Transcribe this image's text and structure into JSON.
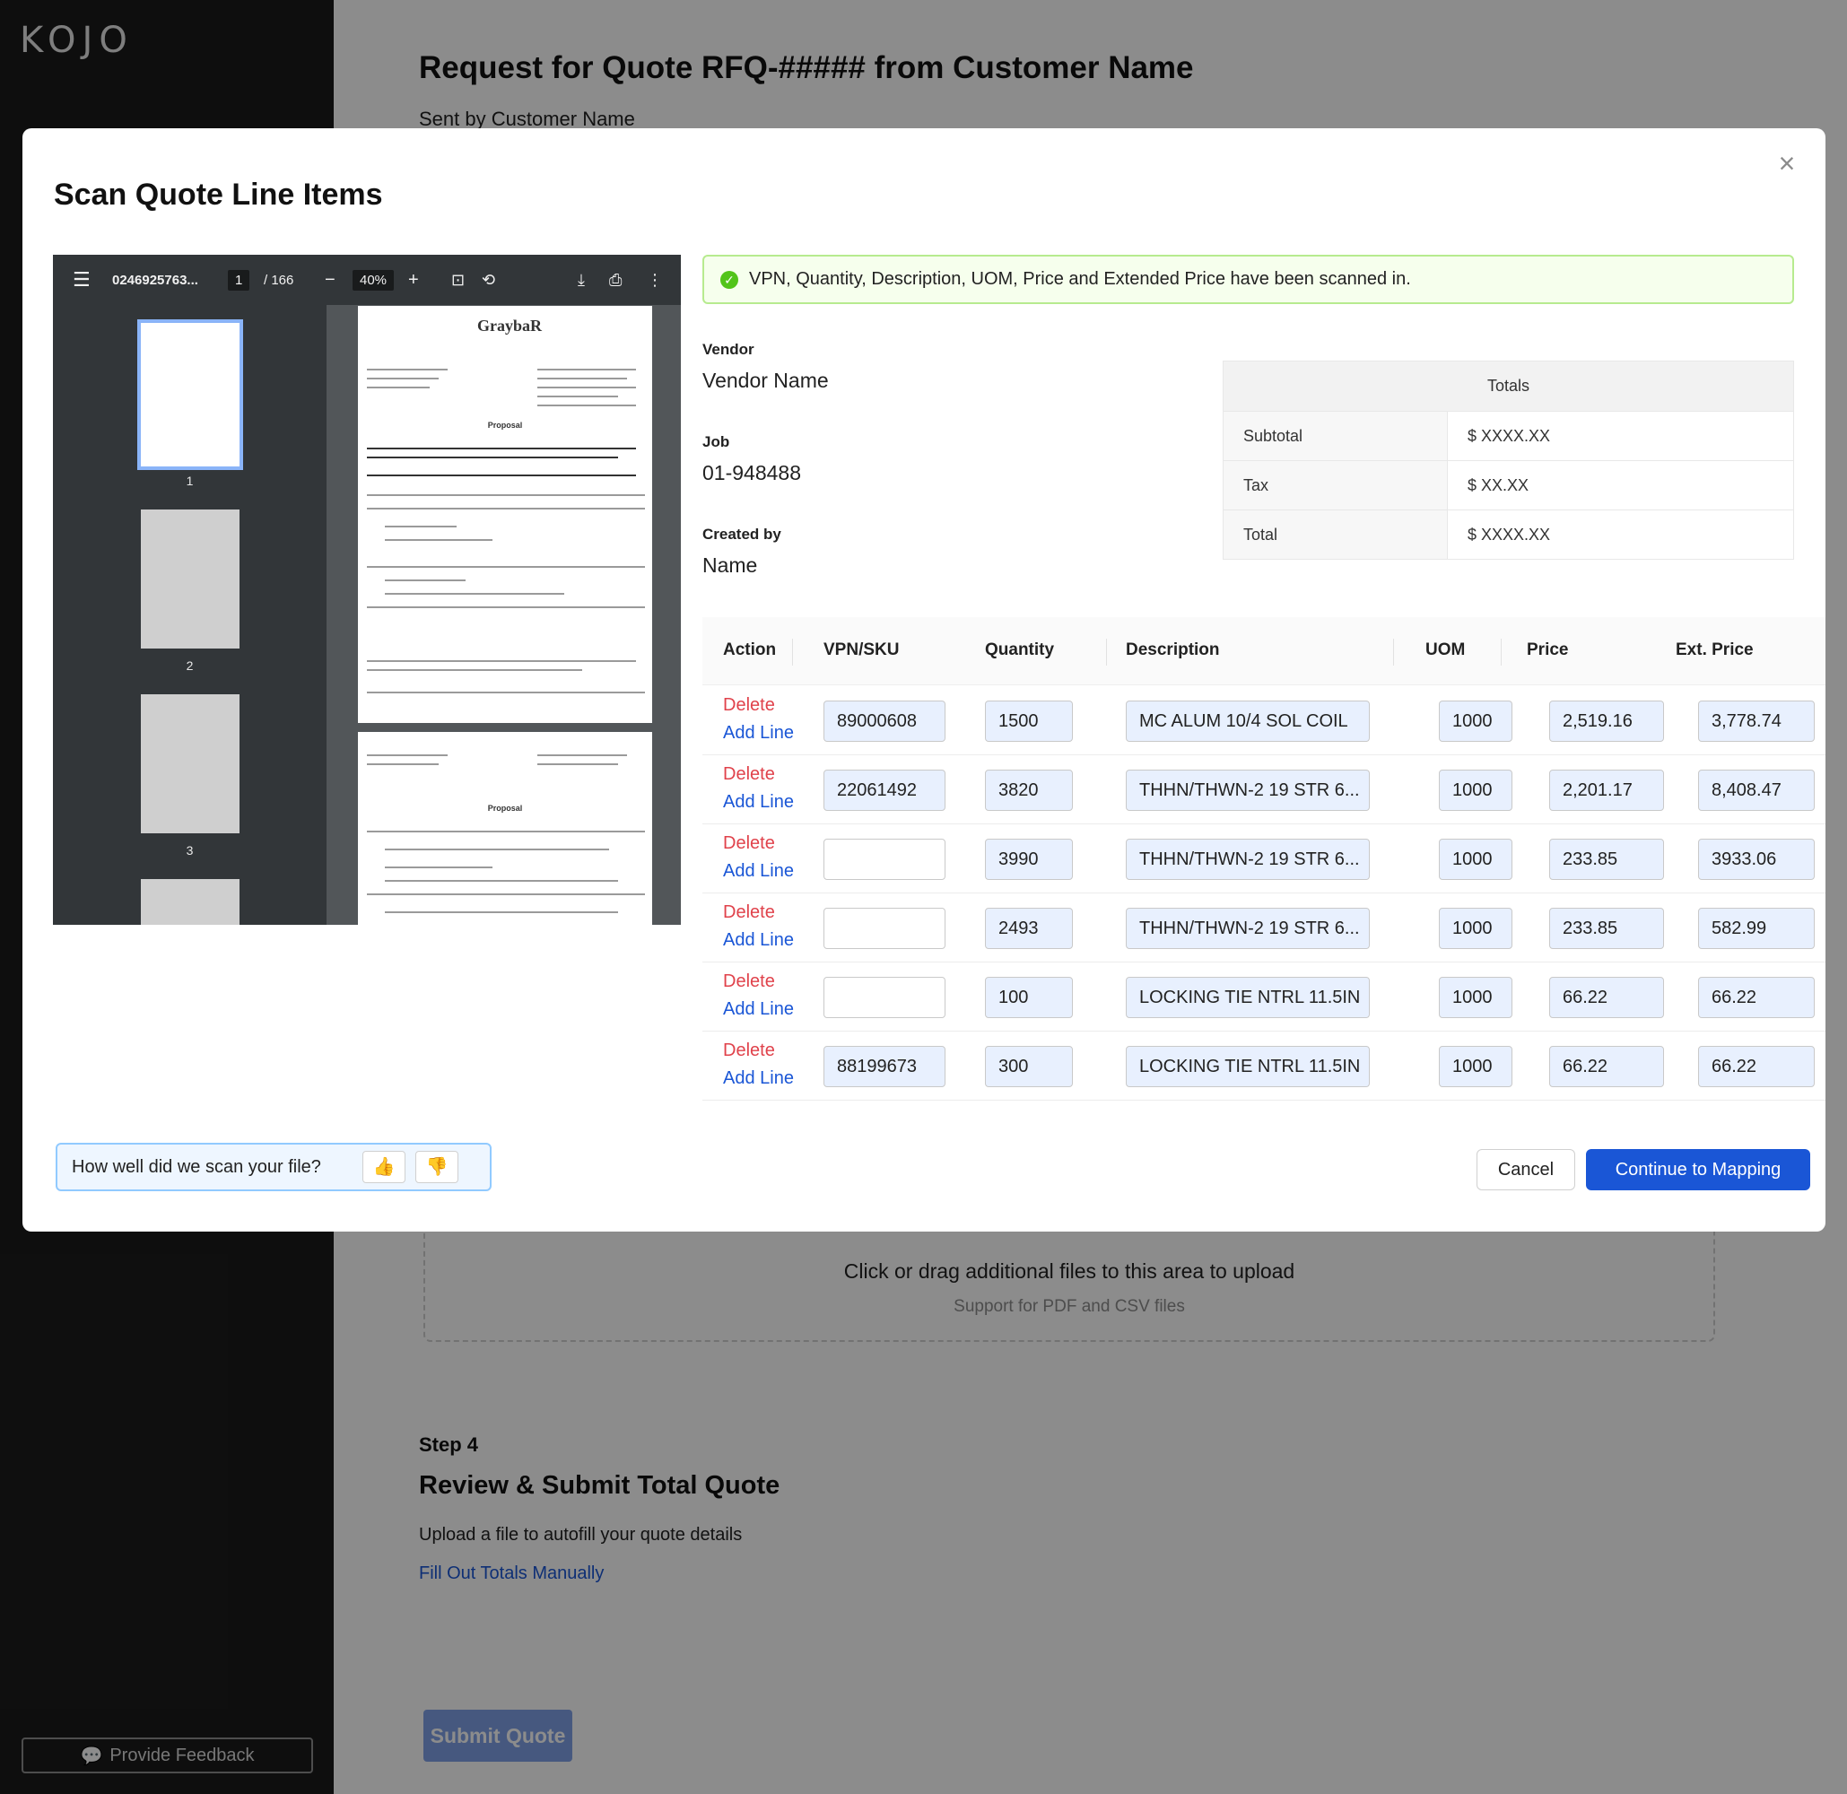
{
  "app": {
    "logo": "KOJO",
    "feedback_label": "Provide Feedback"
  },
  "page": {
    "title": "Request for Quote RFQ-##### from Customer Name",
    "subtitle": "Sent by Customer Name",
    "upload": {
      "main": "Click or drag additional files to this area to upload",
      "hint": "Support for PDF and CSV files"
    },
    "step": {
      "label": "Step 4",
      "title": "Review & Submit Total Quote",
      "description": "Upload a file to autofill your quote details",
      "manual_link": "Fill Out Totals Manually"
    },
    "submit_label": "Submit Quote"
  },
  "modal": {
    "title": "Scan Quote Line Items",
    "pdf": {
      "file_name": "0246925763...",
      "current_page": "1",
      "total_pages": "/ 166",
      "zoom": "40%",
      "thumb_numbers": [
        "1",
        "2",
        "3"
      ],
      "page_heading": "Proposal",
      "brand": "GraybaR"
    },
    "alert": "VPN, Quantity, Description, UOM, Price and Extended Price have been scanned in.",
    "vendor": {
      "label": "Vendor",
      "value": "Vendor Name"
    },
    "job": {
      "label": "Job",
      "value": "01-948488"
    },
    "created_by": {
      "label": "Created by",
      "value": "Name"
    },
    "totals": {
      "header": "Totals",
      "subtotal_label": "Subtotal",
      "subtotal_value": "$ XXXX.XX",
      "tax_label": "Tax",
      "tax_value": "$ XX.XX",
      "total_label": "Total",
      "total_value": "$ XXXX.XX"
    },
    "columns": {
      "action": "Action",
      "vpn": "VPN/SKU",
      "quantity": "Quantity",
      "description": "Description",
      "uom": "UOM",
      "price": "Price",
      "ext_price": "Ext. Price"
    },
    "actions": {
      "delete": "Delete",
      "add": "Add Line"
    },
    "rows": [
      {
        "vpn": "89000608",
        "quantity": "1500",
        "description": "MC ALUM 10/4 SOL COIL",
        "uom": "1000",
        "price": "2,519.16",
        "ext_price": "3,778.74"
      },
      {
        "vpn": "22061492",
        "quantity": "3820",
        "description": "THHN/THWN-2 19 STR 6...",
        "uom": "1000",
        "price": "2,201.17",
        "ext_price": "8,408.47"
      },
      {
        "vpn": "",
        "quantity": "3990",
        "description": "THHN/THWN-2 19 STR 6...",
        "uom": "1000",
        "price": "233.85",
        "ext_price": "3933.06"
      },
      {
        "vpn": "",
        "quantity": "2493",
        "description": "THHN/THWN-2 19 STR 6...",
        "uom": "1000",
        "price": "233.85",
        "ext_price": "582.99"
      },
      {
        "vpn": "",
        "quantity": "100",
        "description": "LOCKING TIE NTRL 11.5IN",
        "uom": "1000",
        "price": "66.22",
        "ext_price": "66.22"
      },
      {
        "vpn": "88199673",
        "quantity": "300",
        "description": "LOCKING TIE NTRL 11.5IN",
        "uom": "1000",
        "price": "66.22",
        "ext_price": "66.22"
      }
    ],
    "rating_question": "How well did we scan your file?",
    "cancel_label": "Cancel",
    "continue_label": "Continue to Mapping"
  },
  "colors": {
    "accent": "#1a56d6",
    "danger": "#e0424b",
    "success": "#52c41a",
    "sidebar": "#1b1b1b"
  }
}
